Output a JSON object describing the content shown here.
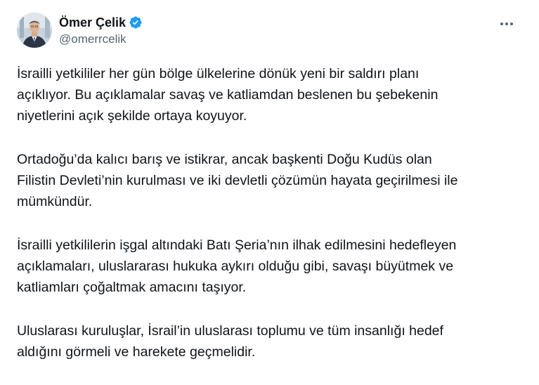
{
  "author": {
    "display_name": "Ömer Çelik",
    "handle": "@omerrcelik",
    "verified": true,
    "verified_color": "#1d9bf0",
    "avatar_icon": "profile-photo"
  },
  "more_icon": "more-horizontal-icon",
  "tweet": {
    "paragraphs": [
      "İsrailli yetkililer her gün bölge ülkelerine dönük yeni bir saldırı planı\naçıklıyor. Bu açıklamalar savaş ve katliamdan beslenen bu şebekenin\nniyetlerini açık şekilde ortaya koyuyor.",
      "Ortadoğu’da kalıcı barış ve istikrar, ancak başkenti Doğu Kudüs olan\nFilistin Devleti’nin kurulması ve iki devletli çözümün hayata geçirilmesi ile\nmümkündür.",
      "İsrailli yetkililerin işgal altındaki Batı Şeria’nın ilhak edilmesini hedefleyen\naçıklamaları, uluslararası hukuka aykırı olduğu gibi, savaşı büyütmek ve\nkatliamları çoğaltmak amacını taşıyor.",
      "Uluslarası kuruluşlar, İsrail’in uluslarası toplumu ve tüm insanlığı  hedef\naldığını görmeli ve harekete geçmelidir."
    ]
  }
}
